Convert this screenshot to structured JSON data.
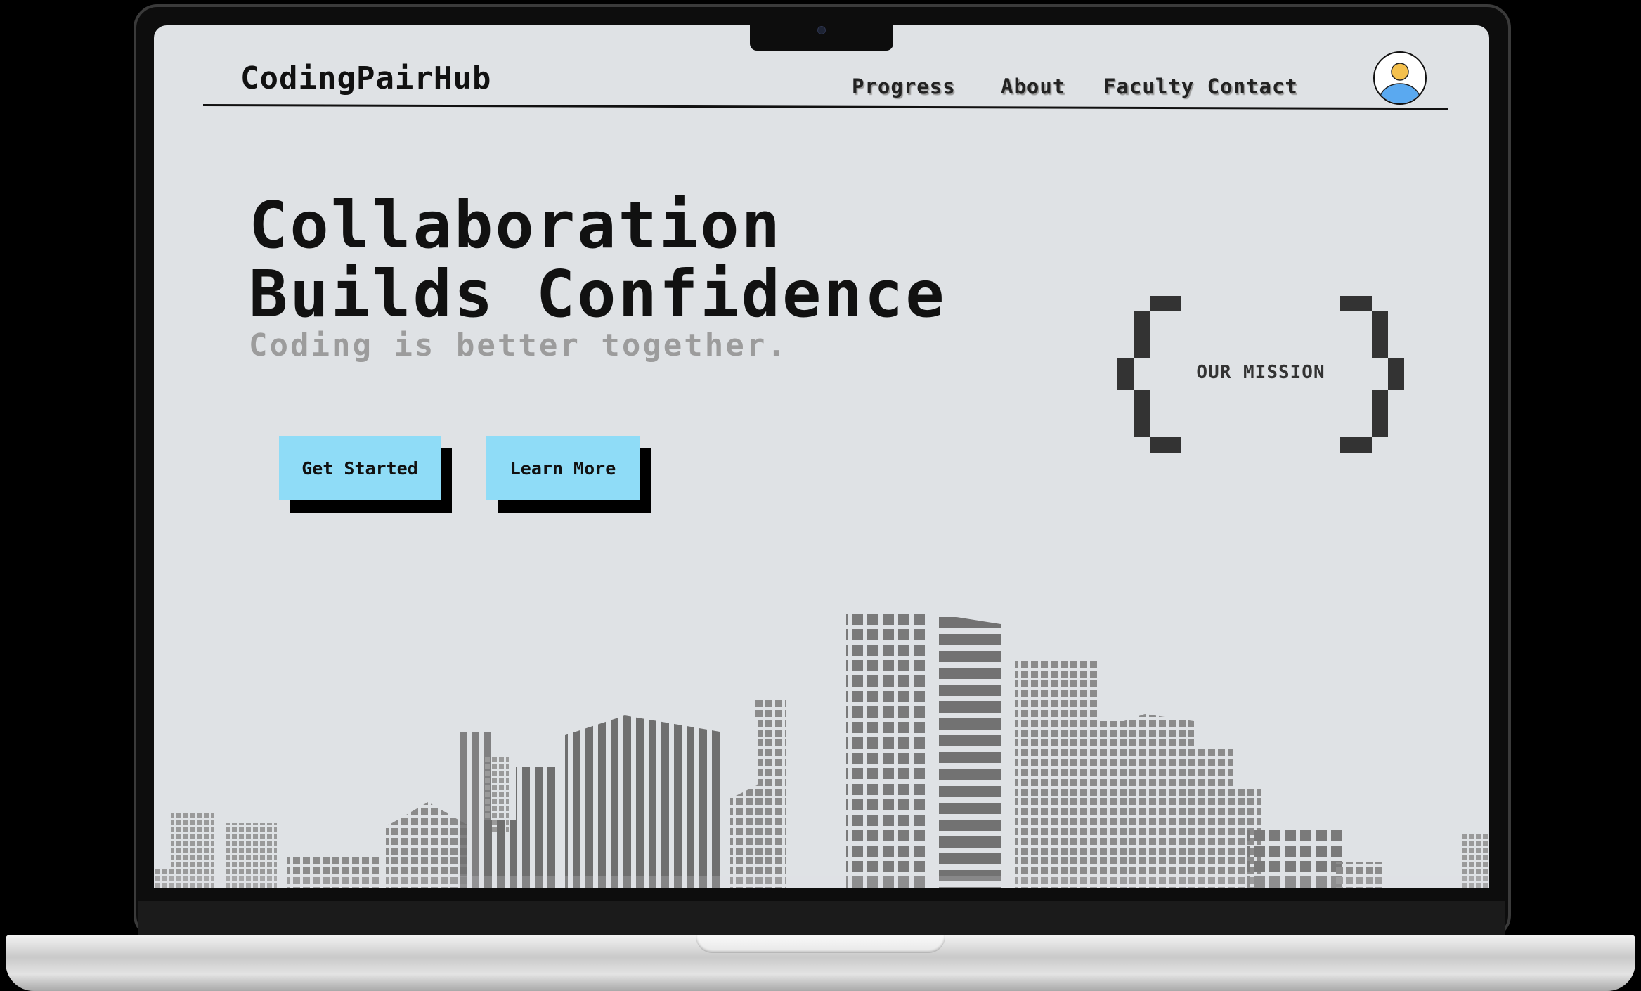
{
  "site": {
    "logo": "CodingPairHub"
  },
  "nav": {
    "items": [
      "Progress",
      "About",
      "Faculty Contact"
    ]
  },
  "hero": {
    "title": "Collaboration\nBuilds Confidence",
    "subtitle": "Coding is better together."
  },
  "buttons": {
    "primary": "Get Started",
    "secondary": "Learn More"
  },
  "mission": {
    "label": "OUR MISSION"
  },
  "colors": {
    "screen_bg": "#dfe2e5",
    "button_bg": "#8fdcf7",
    "avatar_head": "#f4c04d",
    "avatar_body": "#5aa9f0"
  },
  "icons": {
    "avatar": "user-avatar-icon",
    "brackets": "pixel-bracket-icon",
    "skyline": "city-skyline-illustration"
  }
}
